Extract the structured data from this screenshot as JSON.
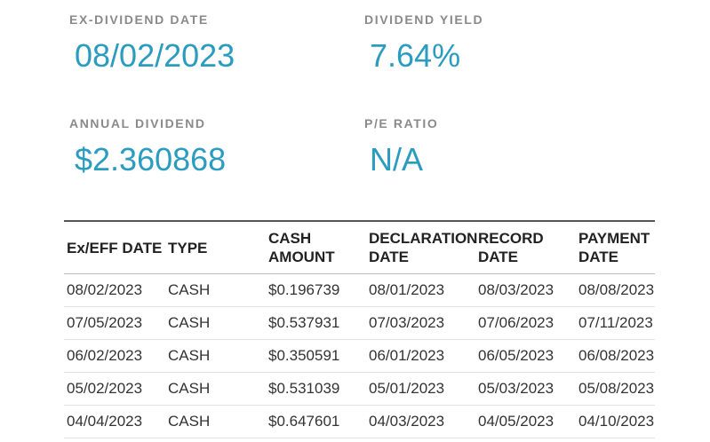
{
  "stats": {
    "ex_dividend": {
      "label": "EX-DIVIDEND DATE",
      "value": "08/02/2023"
    },
    "dividend_yield": {
      "label": "DIVIDEND YIELD",
      "value": "7.64%"
    },
    "annual_dividend": {
      "label": "ANNUAL DIVIDEND",
      "value": "$2.360868"
    },
    "pe_ratio": {
      "label": "P/E RATIO",
      "value": "N/A"
    }
  },
  "table": {
    "headers": {
      "ex_eff_date": "Ex/EFF DATE",
      "type": "TYPE",
      "cash_amount_1": "CASH",
      "cash_amount_2": "AMOUNT",
      "declaration_1": "DECLARATION",
      "declaration_2": "DATE",
      "record_1": "RECORD",
      "record_2": "DATE",
      "payment_1": "PAYMENT",
      "payment_2": "DATE"
    },
    "rows": [
      {
        "ex_date": "08/02/2023",
        "type": "CASH",
        "amount": "$0.196739",
        "declaration": "08/01/2023",
        "record": "08/03/2023",
        "payment": "08/08/2023"
      },
      {
        "ex_date": "07/05/2023",
        "type": "CASH",
        "amount": "$0.537931",
        "declaration": "07/03/2023",
        "record": "07/06/2023",
        "payment": "07/11/2023"
      },
      {
        "ex_date": "06/02/2023",
        "type": "CASH",
        "amount": "$0.350591",
        "declaration": "06/01/2023",
        "record": "06/05/2023",
        "payment": "06/08/2023"
      },
      {
        "ex_date": "05/02/2023",
        "type": "CASH",
        "amount": "$0.531039",
        "declaration": "05/01/2023",
        "record": "05/03/2023",
        "payment": "05/08/2023"
      },
      {
        "ex_date": "04/04/2023",
        "type": "CASH",
        "amount": "$0.647601",
        "declaration": "04/03/2023",
        "record": "04/05/2023",
        "payment": "04/10/2023"
      }
    ]
  },
  "colors": {
    "accent": "#2a9cc0",
    "label": "#8a8a8a",
    "text": "#333333"
  }
}
